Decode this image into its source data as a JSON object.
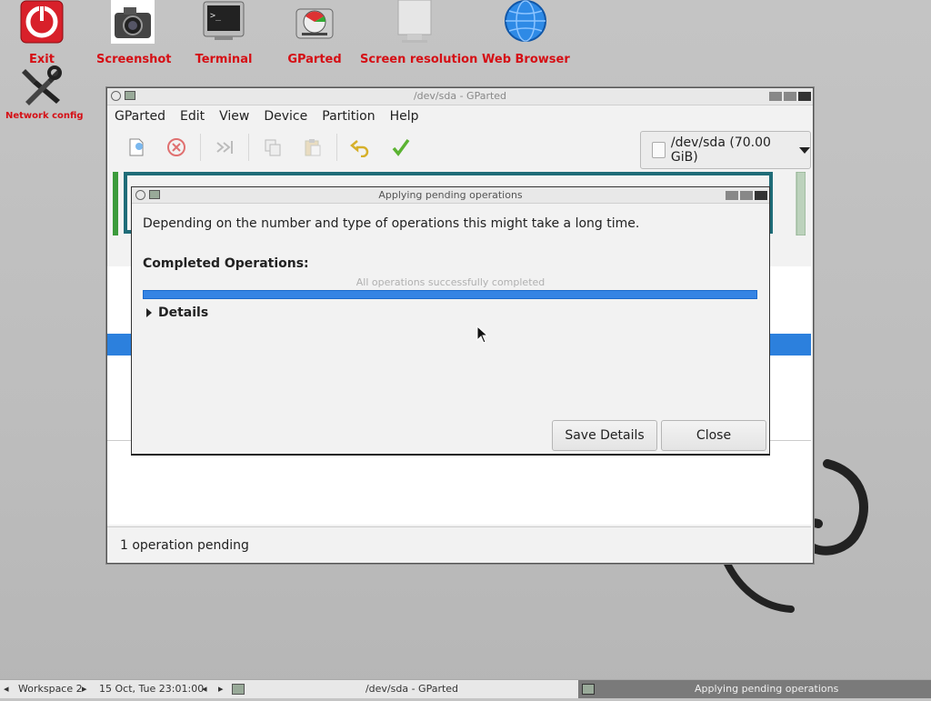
{
  "desktop": {
    "icons": [
      {
        "label": "Exit"
      },
      {
        "label": "Screenshot"
      },
      {
        "label": "Terminal"
      },
      {
        "label": "GParted"
      },
      {
        "label": "Screen resolution"
      },
      {
        "label": "Web Browser"
      },
      {
        "label": "Network config"
      }
    ]
  },
  "main_window": {
    "title": "/dev/sda - GParted",
    "menu": [
      "GParted",
      "Edit",
      "View",
      "Device",
      "Partition",
      "Help"
    ],
    "device_selector": "/dev/sda  (70.00 GiB)",
    "status": "1 operation pending"
  },
  "dialog": {
    "title": "Applying pending operations",
    "message": "Depending on the number and type of operations this might take a long time.",
    "completed_heading": "Completed Operations:",
    "progress_text": "All operations successfully completed",
    "progress": 1.0,
    "details_label": "Details",
    "save_details_label": "Save Details",
    "close_label": "Close"
  },
  "taskbar": {
    "workspace": "Workspace 2",
    "datetime": "15 Oct, Tue 23:01:00",
    "task1": "/dev/sda - GParted",
    "task2": "Applying pending operations"
  },
  "colors": {
    "accent": "#3584e4",
    "desktop_label": "#d50f15"
  }
}
